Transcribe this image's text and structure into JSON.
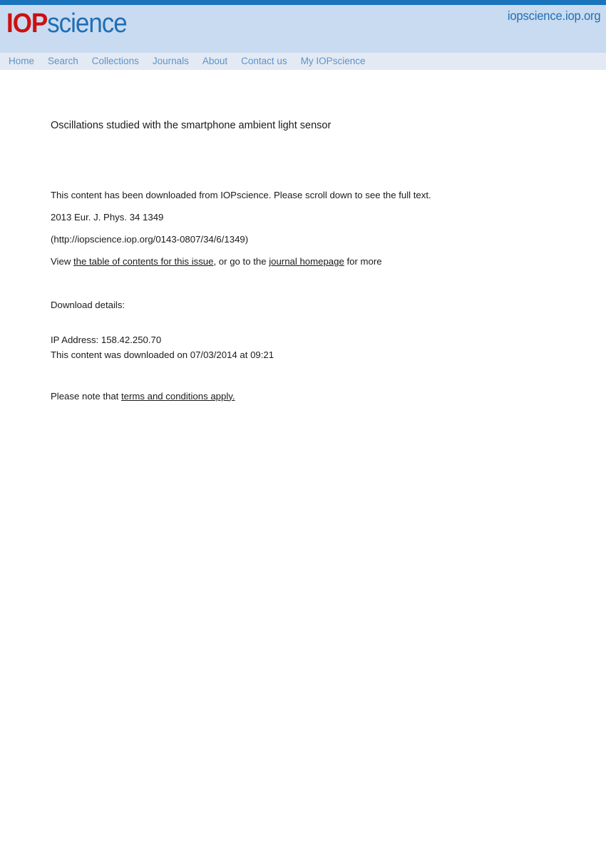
{
  "masthead": {
    "logo_primary": "IOP",
    "logo_secondary": "science",
    "site_url": "iopscience.iop.org",
    "accent_bar_color": "#1a74bb",
    "header_band_color": "#c9dbf1",
    "logo_red": "#cc1111",
    "logo_blue": "#1f6fb5"
  },
  "nav": {
    "background_color": "#e3eaf3",
    "link_color": "#5e93cb",
    "items": [
      {
        "label": "Home"
      },
      {
        "label": "Search"
      },
      {
        "label": "Collections"
      },
      {
        "label": "Journals"
      },
      {
        "label": "About"
      },
      {
        "label": "Contact us"
      },
      {
        "label": "My IOPscience"
      }
    ]
  },
  "article": {
    "title": "Oscillations studied with the smartphone ambient light sensor"
  },
  "notice": {
    "download_notice": "This content has been downloaded from IOPscience. Please scroll down to see the full text.",
    "citation": "2013 Eur. J. Phys. 34 1349",
    "article_url": "(http://iopscience.iop.org/0143-0807/34/6/1349)",
    "view_prefix": "View ",
    "toc_link": "the table of contents for this issue",
    "view_middle": ", or go to the ",
    "journal_link": "journal homepage",
    "view_suffix": " for more"
  },
  "download_details": {
    "heading": "Download details:",
    "ip_address": "IP Address: 158.42.250.70",
    "download_stamp": "This content was downloaded on 07/03/2014 at 09:21"
  },
  "footer": {
    "terms_prefix": "Please note that ",
    "terms_link": "terms and conditions apply."
  }
}
